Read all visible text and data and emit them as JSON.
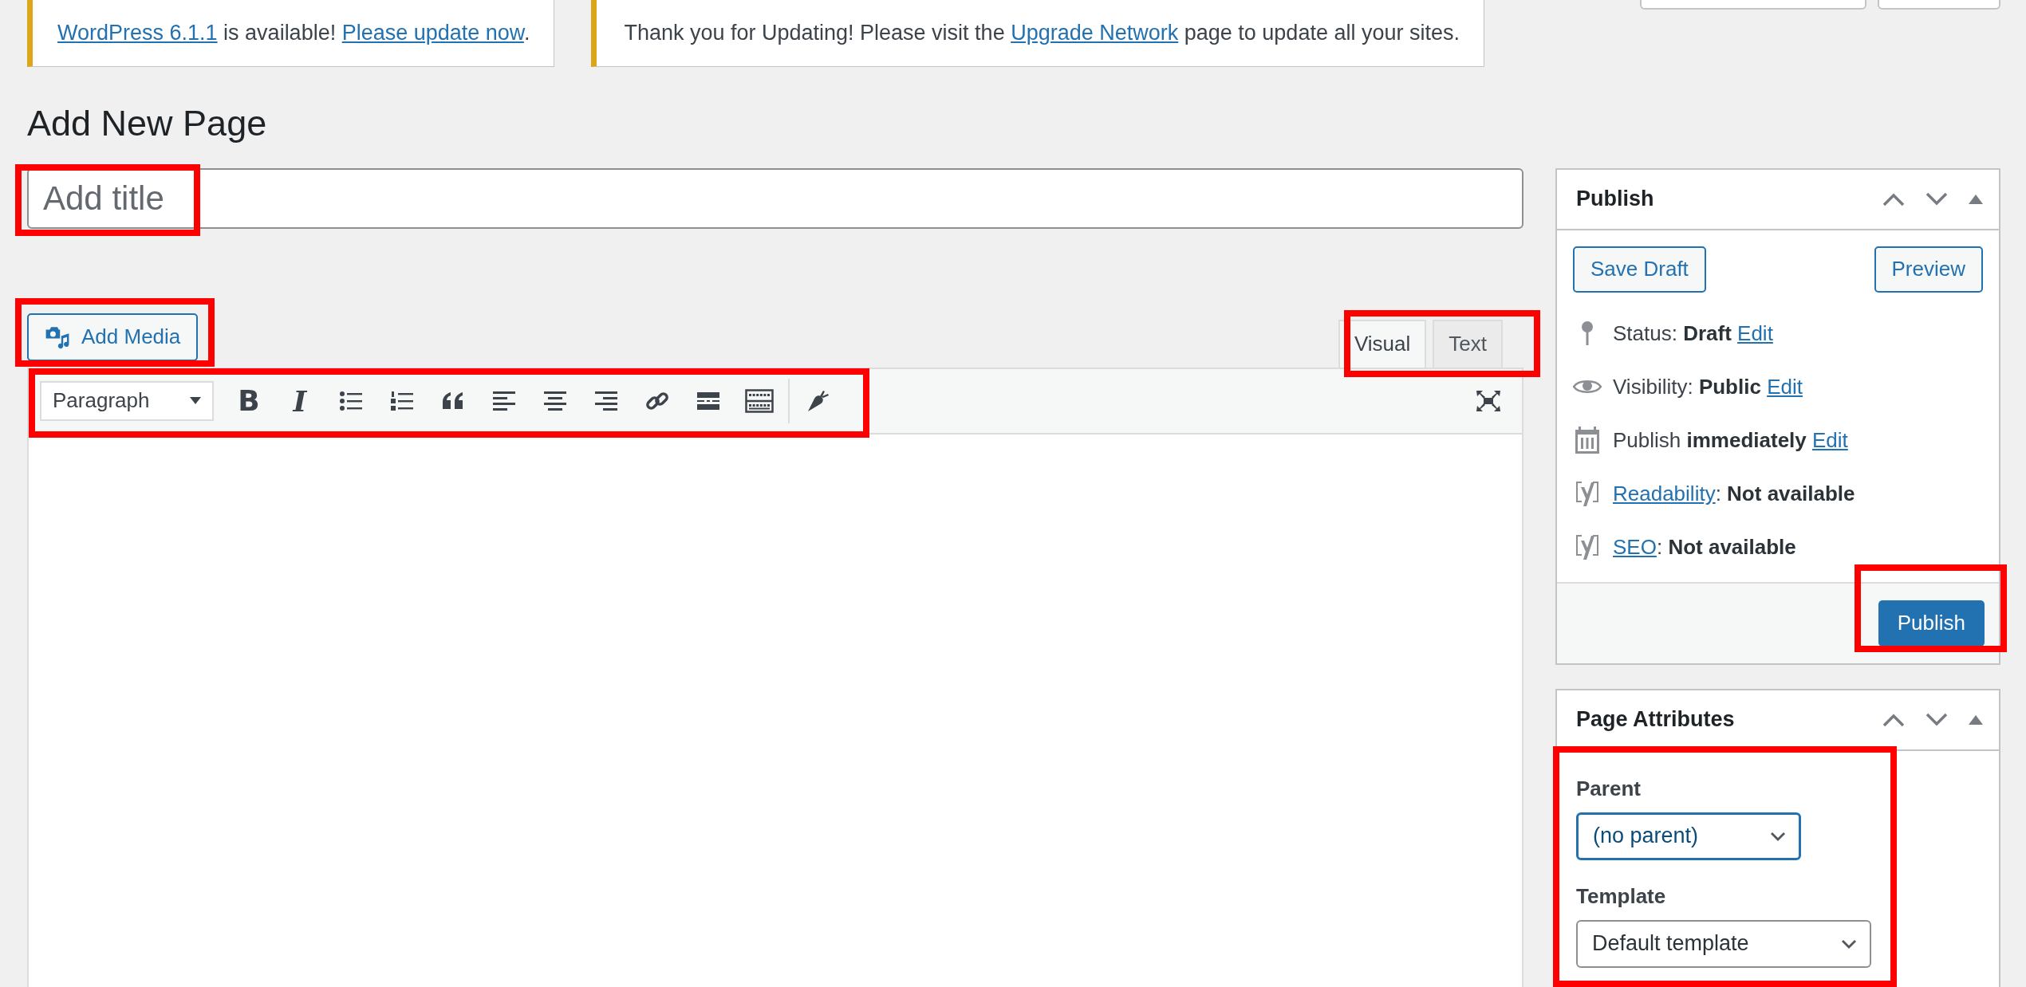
{
  "notices": [
    {
      "kind": "update",
      "segments": [
        {
          "text": "WordPress 6.1.1",
          "kind": "link"
        },
        {
          "text": " is available! ",
          "kind": "text"
        },
        {
          "text": "Please update now",
          "kind": "link"
        },
        {
          "text": ".",
          "kind": "text"
        }
      ]
    },
    {
      "kind": "info",
      "segments": [
        {
          "text": "Thank you for Updating! Please visit the ",
          "kind": "text"
        },
        {
          "text": "Upgrade Network",
          "kind": "link"
        },
        {
          "text": " page to update all your sites.",
          "kind": "text"
        }
      ]
    }
  ],
  "heading": "Add New Page",
  "title_field": {
    "placeholder": "Add title"
  },
  "add_media": "Add Media",
  "editor_tabs": [
    {
      "label": "Visual",
      "selected": true
    },
    {
      "label": "Text",
      "selected": false
    }
  ],
  "format_select": "Paragraph",
  "toolbar": [
    {
      "kind": "bold",
      "glyph": "B"
    },
    {
      "kind": "italic",
      "glyph": "I"
    },
    {
      "kind": "bullets"
    },
    {
      "kind": "numbers"
    },
    {
      "kind": "quote"
    },
    {
      "kind": "align-left"
    },
    {
      "kind": "align-center"
    },
    {
      "kind": "align-right"
    },
    {
      "kind": "link"
    },
    {
      "kind": "more"
    },
    {
      "kind": "kitchen"
    },
    {
      "kind": "carrot"
    }
  ],
  "publish": {
    "title": "Publish",
    "save_draft": "Save Draft",
    "preview": "Preview",
    "rows": [
      {
        "kind": "status",
        "segments": [
          {
            "text": "Status: ",
            "kind": "text"
          },
          {
            "text": "Draft ",
            "kind": "bold"
          },
          {
            "text": "Edit",
            "kind": "link"
          }
        ]
      },
      {
        "kind": "visibility",
        "segments": [
          {
            "text": "Visibility: ",
            "kind": "text"
          },
          {
            "text": "Public ",
            "kind": "bold"
          },
          {
            "text": "Edit",
            "kind": "link"
          }
        ]
      },
      {
        "kind": "schedule",
        "segments": [
          {
            "text": "Publish ",
            "kind": "text"
          },
          {
            "text": "immediately ",
            "kind": "bold"
          },
          {
            "text": "Edit",
            "kind": "link"
          }
        ]
      },
      {
        "kind": "seo-score",
        "segments": [
          {
            "text": "Readability",
            "kind": "link"
          },
          {
            "text": ": ",
            "kind": "text"
          },
          {
            "text": "Not available",
            "kind": "bold"
          }
        ]
      },
      {
        "kind": "seo-score",
        "segments": [
          {
            "text": "SEO",
            "kind": "link"
          },
          {
            "text": ": ",
            "kind": "text"
          },
          {
            "text": "Not available",
            "kind": "bold"
          }
        ]
      }
    ],
    "publish_button": "Publish"
  },
  "page_attributes": {
    "title": "Page Attributes",
    "fields": [
      {
        "label": "Parent",
        "value": "(no parent)",
        "focused": true
      },
      {
        "label": "Template",
        "value": "Default template",
        "focused": false
      }
    ]
  }
}
